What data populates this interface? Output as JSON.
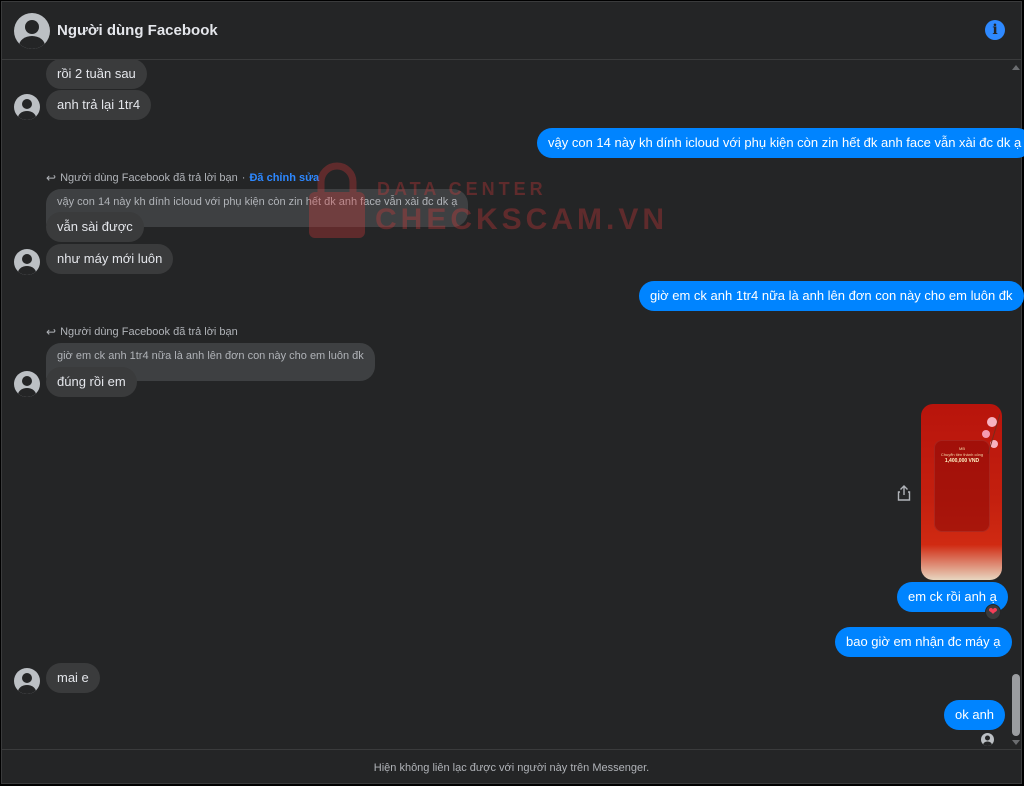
{
  "header": {
    "title": "Người dùng Facebook",
    "info_icon": "info-icon"
  },
  "messages": {
    "m1": "rồi 2 tuần sau",
    "m2": "anh trả lại 1tr4",
    "m3": "vậy con 14 này kh dính icloud với phụ kiện còn zin hết đk anh face vẫn xài đc dk ạ",
    "reply1": {
      "header": "Người dùng Facebook đã trả lời bạn",
      "separator": "·",
      "edited": "Đã chỉnh sửa",
      "quoted": "vậy con 14 này kh dính icloud với phụ kiện còn zin hết đk anh face vẫn xài đc dk ạ",
      "text": "vẫn sài được"
    },
    "m4": "như máy mới luôn",
    "m5": "giờ em ck anh 1tr4 nữa là anh lên đơn con này cho em luôn đk",
    "reply2": {
      "header": "Người dùng Facebook đã trả lời bạn",
      "quoted": "giờ em ck anh 1tr4 nữa là anh lên đơn con này cho em luôn đk",
      "text": "đúng rồi em"
    },
    "image": {
      "brand": "MB",
      "title": "Chuyển tiền thành công",
      "amount": "1,400,000 VND"
    },
    "m6": "em ck rồi anh ạ",
    "m6_reaction": "❤",
    "m7": "bao giờ em nhận đc máy ạ",
    "m8": "mai e",
    "m9": "ok anh"
  },
  "watermark": {
    "line1": "DATA CENTER",
    "line2": "CHECKSCAM.VN"
  },
  "footer": {
    "notice": "Hiện không liên lạc được với người này trên Messenger."
  },
  "colors": {
    "background": "#242526",
    "incoming_bubble": "#3a3b3c",
    "outgoing_bubble": "#0084ff",
    "accent": "#2d88ff"
  }
}
